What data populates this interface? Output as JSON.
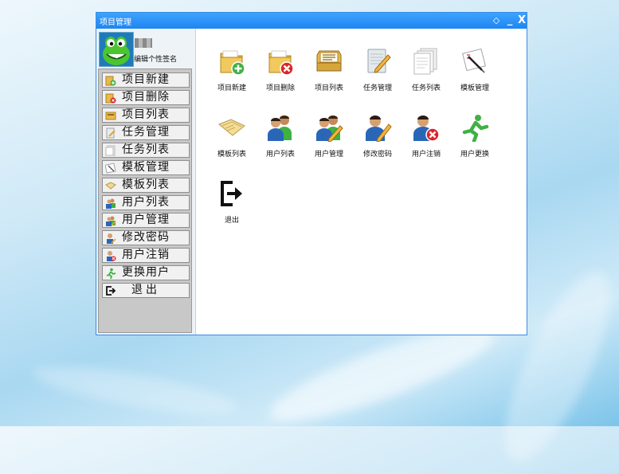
{
  "window": {
    "title": "项目管理",
    "buttons": {
      "restore": "◇",
      "minimize": "_",
      "close": "X"
    }
  },
  "profile": {
    "signature": "编辑个性签名"
  },
  "sidebar": {
    "items": [
      {
        "label": "项目新建",
        "icon": "folder-add-icon"
      },
      {
        "label": "项目删除",
        "icon": "folder-delete-icon"
      },
      {
        "label": "项目列表",
        "icon": "folder-open-icon"
      },
      {
        "label": "任务管理",
        "icon": "notepad-edit-icon"
      },
      {
        "label": "任务列表",
        "icon": "documents-icon"
      },
      {
        "label": "模板管理",
        "icon": "template-edit-icon"
      },
      {
        "label": "模板列表",
        "icon": "template-list-icon"
      },
      {
        "label": "用户列表",
        "icon": "users-icon"
      },
      {
        "label": "用户管理",
        "icon": "users-edit-icon"
      },
      {
        "label": "修改密码",
        "icon": "user-edit-icon"
      },
      {
        "label": "用户注销",
        "icon": "user-delete-icon"
      },
      {
        "label": "更换用户",
        "icon": "running-man-icon"
      },
      {
        "label": "退出",
        "icon": "exit-icon"
      }
    ]
  },
  "tiles": [
    {
      "label": "项目新建",
      "icon": "folder-add-icon"
    },
    {
      "label": "项目删除",
      "icon": "folder-delete-icon"
    },
    {
      "label": "项目列表",
      "icon": "folder-open-icon"
    },
    {
      "label": "任务管理",
      "icon": "notepad-edit-icon"
    },
    {
      "label": "任务列表",
      "icon": "documents-icon"
    },
    {
      "label": "模板管理",
      "icon": "template-edit-icon"
    },
    {
      "label": "模板列表",
      "icon": "template-list-icon"
    },
    {
      "label": "用户列表",
      "icon": "users-icon"
    },
    {
      "label": "用户管理",
      "icon": "users-edit-icon"
    },
    {
      "label": "修改密码",
      "icon": "user-edit-icon"
    },
    {
      "label": "用户注销",
      "icon": "user-delete-icon"
    },
    {
      "label": "用户更换",
      "icon": "running-man-icon"
    },
    {
      "label": "退出",
      "icon": "exit-icon"
    }
  ],
  "colors": {
    "titlebar": "#1f86f0",
    "menu_panel": "#c8c8c8",
    "accent_green": "#3fb143",
    "accent_red": "#d9252a",
    "folder": "#e9b949"
  }
}
